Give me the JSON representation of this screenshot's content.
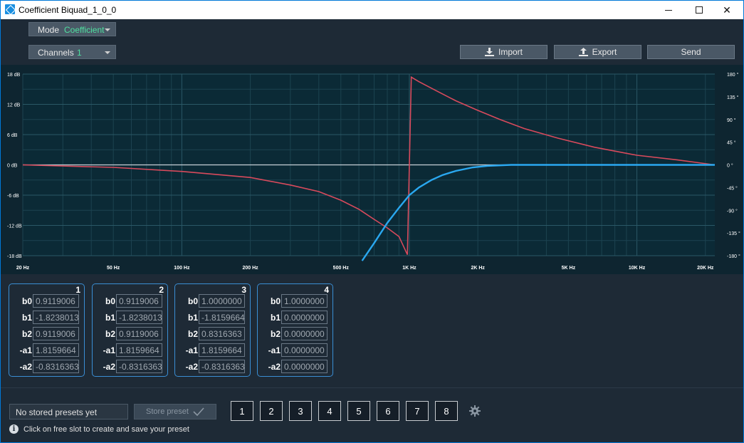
{
  "window": {
    "title": "Coefficient Biquad_1_0_0"
  },
  "mode": {
    "label": "Mode",
    "value": "Coefficient"
  },
  "channels": {
    "label": "Channels",
    "value": "1"
  },
  "toolbar": {
    "import_label": "Import",
    "export_label": "Export",
    "send_label": "Send"
  },
  "chart_data": {
    "type": "line",
    "title": "",
    "xlabel": "",
    "ylabel": "",
    "x_scale": "log",
    "x_ticks": [
      "20 Hz",
      "50 Hz",
      "100 Hz",
      "200 Hz",
      "500 Hz",
      "1K Hz",
      "2K Hz",
      "5K Hz",
      "10K Hz",
      "20K Hz"
    ],
    "y_left_ticks": [
      "18 dB",
      "12 dB",
      "6 dB",
      "0 dB",
      "-6 dB",
      "-12 dB",
      "-18 dB"
    ],
    "y_right_ticks": [
      "180 °",
      "135 °",
      "90 °",
      "45 °",
      "0 °",
      "-45 °",
      "-90 °",
      "-135 °",
      "-180 °"
    ],
    "ylim_left": [
      -18,
      18
    ],
    "ylim_right": [
      -180,
      180
    ],
    "xlim": [
      20,
      22000
    ],
    "grid": true,
    "series": [
      {
        "axis": "right",
        "color": "#d84a5c",
        "x": [
          20,
          50,
          100,
          200,
          300,
          400,
          500,
          600,
          700,
          800,
          900,
          980,
          1020,
          1100,
          1300,
          1600,
          2000,
          2500,
          3200,
          4500,
          6500,
          10000,
          15000,
          22000
        ],
        "values": [
          0,
          -5,
          -13,
          -25,
          -40,
          -53,
          -70,
          -88,
          -108,
          -125,
          -142,
          -178,
          174,
          165,
          148,
          127,
          108,
          90,
          72,
          53,
          35,
          19,
          10,
          0
        ]
      },
      {
        "axis": "left",
        "color": "#2aa8f0",
        "x": [
          620,
          700,
          800,
          900,
          1000,
          1100,
          1250,
          1400,
          1600,
          1900,
          2200,
          2800,
          3500,
          22000
        ],
        "values": [
          -19,
          -15.5,
          -11.5,
          -8.5,
          -6.0,
          -4.5,
          -3.0,
          -2.0,
          -1.2,
          -0.5,
          -0.2,
          0,
          0,
          0
        ]
      }
    ]
  },
  "coefficients": {
    "labels": [
      "b0",
      "b1",
      "b2",
      "-a1",
      "-a2"
    ],
    "cards": [
      {
        "num": "1",
        "values": [
          "0.9119006",
          "-1.8238013",
          "0.9119006",
          "1.8159664",
          "-0.8316363"
        ]
      },
      {
        "num": "2",
        "values": [
          "0.9119006",
          "-1.8238013",
          "0.9119006",
          "1.8159664",
          "-0.8316363"
        ]
      },
      {
        "num": "3",
        "values": [
          "1.0000000",
          "-1.8159664",
          "0.8316363",
          "1.8159664",
          "-0.8316363"
        ]
      },
      {
        "num": "4",
        "values": [
          "1.0000000",
          "0.0000000",
          "0.0000000",
          "0.0000000",
          "0.0000000"
        ]
      }
    ]
  },
  "presets": {
    "field_text": "No stored presets yet",
    "store_label": "Store preset",
    "slots": [
      "1",
      "2",
      "3",
      "4",
      "5",
      "6",
      "7",
      "8"
    ],
    "info_text": "Click on free slot to create and save your preset"
  },
  "icons": {
    "download": "download-icon",
    "upload": "upload-icon",
    "check": "check-icon",
    "gear": "gear-icon",
    "info": "info-icon"
  }
}
